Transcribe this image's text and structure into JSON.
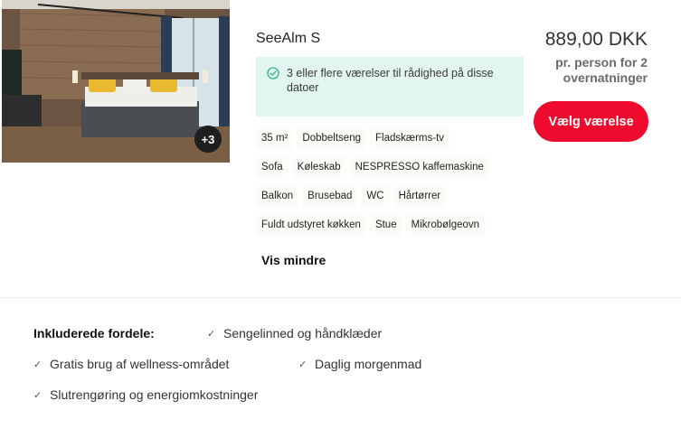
{
  "room": {
    "name": "SeeAlm S",
    "more_photos": "+3",
    "availability": "3 eller flere værelser til rådighed på disse datoer",
    "amenity_rows": [
      [
        "35 m²",
        "Dobbeltseng",
        "Fladskærms-tv"
      ],
      [
        "Sofa",
        "Køleskab",
        "NESPRESSO kaffemaskine"
      ],
      [
        "Balkon",
        "Brusebad",
        "WC",
        "Hårtørrer"
      ],
      [
        "Fuldt udstyret køkken",
        "Stue",
        "Mikrobølgeovn"
      ]
    ],
    "show_less": "Vis mindre"
  },
  "pricing": {
    "price": "889,00 DKK",
    "per": "pr. person for 2 overnatninger",
    "select_button": "Vælg værelse"
  },
  "benefits": {
    "label": "Inkluderede fordele:",
    "items": [
      "Sengelinned og håndklæder",
      "Gratis brug af wellness-området",
      "Daglig morgenmad",
      "Slutrengøring og energiomkostninger"
    ]
  },
  "colors": {
    "accent": "#ee0a2c",
    "availability_bg": "#e3f5f1",
    "availability_icon": "#2fb58a"
  }
}
